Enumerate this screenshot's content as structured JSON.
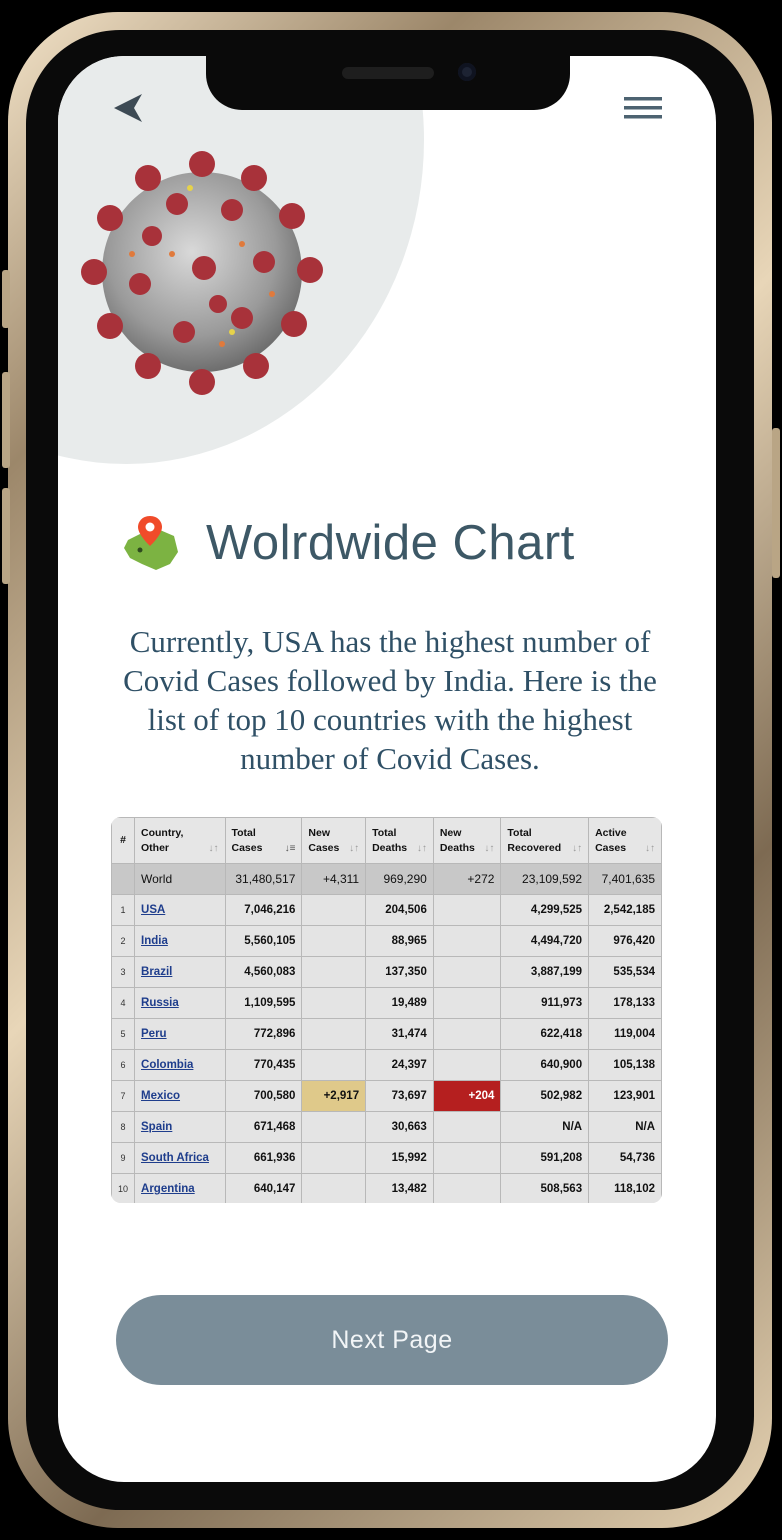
{
  "header": {
    "back_icon": "chevron-left-icon",
    "menu_icon": "hamburger-menu-icon"
  },
  "hero": {
    "image": "coronavirus-illustration",
    "map_icon": "map-pin-icon"
  },
  "title": "Wolrdwide Chart",
  "description": "Currently, USA has the highest number of Covid Cases followed by India. Here is the list of top 10 countries with the highest number of Covid Cases.",
  "table": {
    "headers": [
      {
        "line1": "#",
        "line2": ""
      },
      {
        "line1": "Country,",
        "line2": "Other"
      },
      {
        "line1": "Total",
        "line2": "Cases"
      },
      {
        "line1": "New",
        "line2": "Cases"
      },
      {
        "line1": "Total",
        "line2": "Deaths"
      },
      {
        "line1": "New",
        "line2": "Deaths"
      },
      {
        "line1": "Total",
        "line2": "Recovered"
      },
      {
        "line1": "Active",
        "line2": "Cases"
      }
    ],
    "world": {
      "country": "World",
      "total_cases": "31,480,517",
      "new_cases": "+4,311",
      "total_deaths": "969,290",
      "new_deaths": "+272",
      "total_recovered": "23,109,592",
      "active_cases": "7,401,635"
    },
    "rows": [
      {
        "rank": "1",
        "country": "USA",
        "total_cases": "7,046,216",
        "new_cases": "",
        "total_deaths": "204,506",
        "new_deaths": "",
        "total_recovered": "4,299,525",
        "active_cases": "2,542,185"
      },
      {
        "rank": "2",
        "country": "India",
        "total_cases": "5,560,105",
        "new_cases": "",
        "total_deaths": "88,965",
        "new_deaths": "",
        "total_recovered": "4,494,720",
        "active_cases": "976,420"
      },
      {
        "rank": "3",
        "country": "Brazil",
        "total_cases": "4,560,083",
        "new_cases": "",
        "total_deaths": "137,350",
        "new_deaths": "",
        "total_recovered": "3,887,199",
        "active_cases": "535,534"
      },
      {
        "rank": "4",
        "country": "Russia",
        "total_cases": "1,109,595",
        "new_cases": "",
        "total_deaths": "19,489",
        "new_deaths": "",
        "total_recovered": "911,973",
        "active_cases": "178,133"
      },
      {
        "rank": "5",
        "country": "Peru",
        "total_cases": "772,896",
        "new_cases": "",
        "total_deaths": "31,474",
        "new_deaths": "",
        "total_recovered": "622,418",
        "active_cases": "119,004"
      },
      {
        "rank": "6",
        "country": "Colombia",
        "total_cases": "770,435",
        "new_cases": "",
        "total_deaths": "24,397",
        "new_deaths": "",
        "total_recovered": "640,900",
        "active_cases": "105,138"
      },
      {
        "rank": "7",
        "country": "Mexico",
        "total_cases": "700,580",
        "new_cases": "+2,917",
        "total_deaths": "73,697",
        "new_deaths": "+204",
        "total_recovered": "502,982",
        "active_cases": "123,901"
      },
      {
        "rank": "8",
        "country": "Spain",
        "total_cases": "671,468",
        "new_cases": "",
        "total_deaths": "30,663",
        "new_deaths": "",
        "total_recovered": "N/A",
        "active_cases": "N/A"
      },
      {
        "rank": "9",
        "country": "South Africa",
        "total_cases": "661,936",
        "new_cases": "",
        "total_deaths": "15,992",
        "new_deaths": "",
        "total_recovered": "591,208",
        "active_cases": "54,736"
      },
      {
        "rank": "10",
        "country": "Argentina",
        "total_cases": "640,147",
        "new_cases": "",
        "total_deaths": "13,482",
        "new_deaths": "",
        "total_recovered": "508,563",
        "active_cases": "118,102"
      }
    ]
  },
  "next_button": "Next Page",
  "colors": {
    "title": "#3d5866",
    "description": "#2f5066",
    "button": "#7a8d99",
    "new_cases_highlight": "#dfc98a",
    "new_deaths_highlight": "#b51f1f",
    "link": "#1e3d8c"
  }
}
